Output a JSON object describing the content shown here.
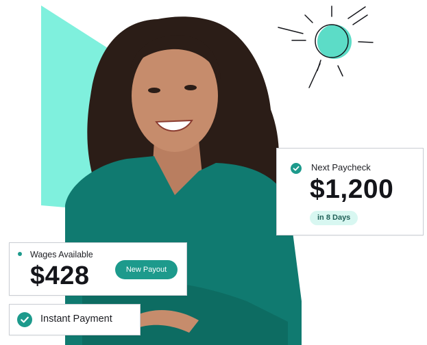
{
  "colors": {
    "accent": "#1d9a8c",
    "mint": "#7ff0dd",
    "pill_bg": "#d8f7f1",
    "text": "#14151a"
  },
  "hero": {
    "image": "smiling-woman-teal-shirt"
  },
  "paycheck_card": {
    "icon": "check-circle-icon",
    "title": "Next Paycheck",
    "amount": "$1,200",
    "badge": "in 8 Days"
  },
  "wages_card": {
    "icon": "dot-icon",
    "title": "Wages Available",
    "amount": "$428",
    "button_label": "New Payout"
  },
  "instant_card": {
    "icon": "check-circle-icon",
    "label": "Instant Payment"
  }
}
